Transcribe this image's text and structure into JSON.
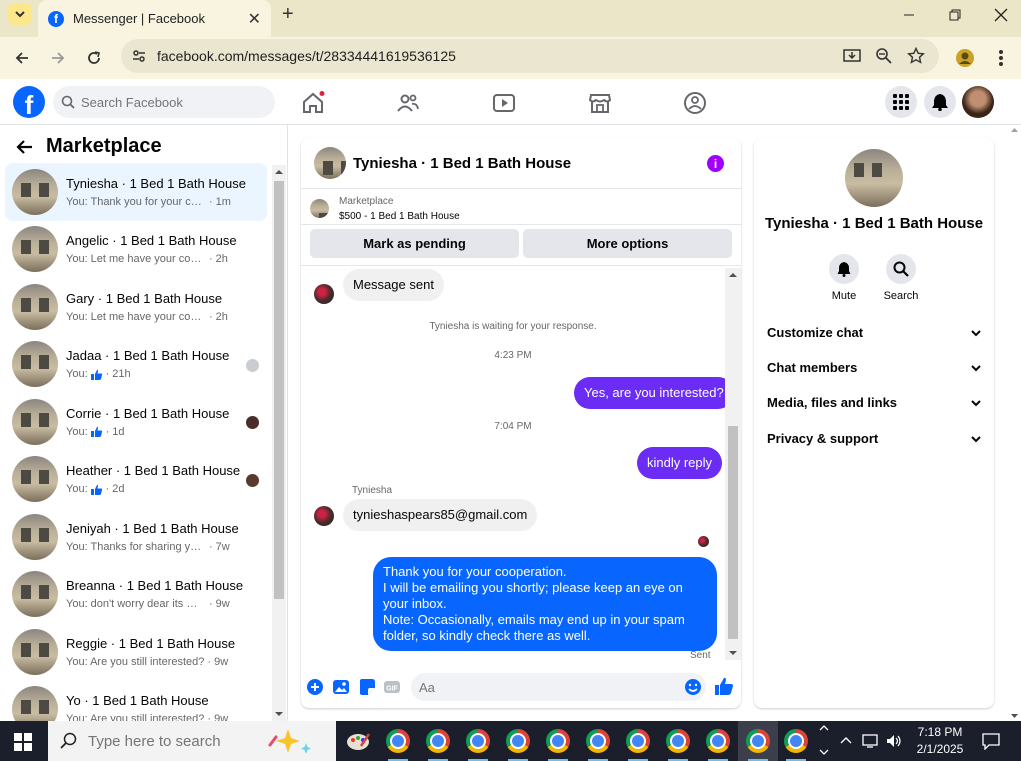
{
  "browser": {
    "tab_title": "Messenger | Facebook",
    "url": "facebook.com/messages/t/28334441619536125"
  },
  "facebook": {
    "search_placeholder": "Search Facebook"
  },
  "sidebar": {
    "title": "Marketplace",
    "conversations": [
      {
        "name": "Tyniesha · 1 Bed 1 Bath House",
        "preview": "You: Thank you for your cooperati...",
        "time": "1m",
        "like": false
      },
      {
        "name": "Angelic · 1 Bed 1 Bath House",
        "preview": "You: Let me have your contact nu...",
        "time": "2h",
        "like": false
      },
      {
        "name": "Gary · 1 Bed 1 Bath House",
        "preview": "You: Let me have your contact nu...",
        "time": "2h",
        "like": false
      },
      {
        "name": "Jadaa · 1 Bed 1 Bath House",
        "preview": "You:",
        "time": "21h",
        "like": true
      },
      {
        "name": "Corrie · 1 Bed 1 Bath House",
        "preview": "You:",
        "time": "1d",
        "like": true
      },
      {
        "name": "Heather · 1 Bed 1 Bath House",
        "preview": "You:",
        "time": "2d",
        "like": true
      },
      {
        "name": "Jeniyah · 1 Bed 1 Bath House",
        "preview": "You: Thanks for sharing your num...",
        "time": "7w",
        "like": false
      },
      {
        "name": "Breanna · 1 Bed 1 Bath House",
        "preview": "You: don't worry dear its my broth...",
        "time": "9w",
        "like": false
      },
      {
        "name": "Reggie · 1 Bed 1 Bath House",
        "preview": "You: Are you still interested?",
        "time": "9w",
        "like": false
      },
      {
        "name": "Yo · 1 Bed 1 Bath House",
        "preview": "You: Are you still interested?",
        "time": "9w",
        "like": false
      }
    ]
  },
  "chat": {
    "title": "Tyniesha · 1 Bed 1 Bath House",
    "marketplace_label": "Marketplace",
    "listing": "$500 - 1 Bed 1 Bath House",
    "btn_pending": "Mark as pending",
    "btn_more": "More options",
    "messages": {
      "m1": "Message sent",
      "waiting": "Tyniesha is waiting for your response.",
      "t1": "4:23 PM",
      "m2": "Yes, are you interested?",
      "t2": "7:04 PM",
      "m3": "kindly reply",
      "sender": "Tyniesha",
      "m4": "tynieshaspears85@gmail.com",
      "m5_l1": "Thank you for your cooperation.",
      "m5_l2": "I will be emailing you shortly; please keep an eye on your inbox.",
      "m5_l3": "Note: Occasionally, emails may end up in your spam folder, so kindly check there as well.",
      "status": "Sent"
    },
    "composer_placeholder": "Aa"
  },
  "details": {
    "name": "Tyniesha · 1 Bed 1 Bath House",
    "mute": "Mute",
    "search": "Search",
    "sections": [
      "Customize chat",
      "Chat members",
      "Media, files and links",
      "Privacy & support"
    ]
  },
  "taskbar": {
    "search_placeholder": "Type here to search",
    "time": "7:18 PM",
    "date": "2/1/2025"
  },
  "colors": {
    "brand": "#0866ff",
    "outgoing_bubble": "#6b2cf5",
    "info_icon": "#a100ff"
  }
}
